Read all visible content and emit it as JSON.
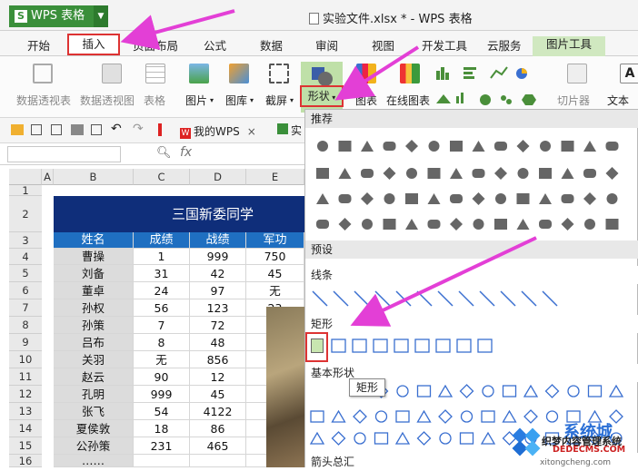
{
  "app": {
    "name": "WPS 表格",
    "doc_title": "实验文件.xlsx * - WPS 表格"
  },
  "tabs": [
    "开始",
    "插入",
    "页面布局",
    "公式",
    "数据",
    "审阅",
    "视图",
    "开发工具",
    "云服务",
    "图片工具"
  ],
  "ribbon": {
    "items": [
      "数据透视表",
      "数据透视图",
      "表格",
      "图片",
      "图库",
      "截屏",
      "形状",
      "图表",
      "在线图表",
      "切片器",
      "文本框"
    ]
  },
  "quickbar": {
    "wps_link": "我的WPS",
    "tab_partial": "实"
  },
  "formula": {
    "fx": "fx",
    "zoom_icon": "search-icon"
  },
  "sheet": {
    "columns": [
      "A",
      "B",
      "C",
      "D",
      "E"
    ],
    "rows": [
      "1",
      "2",
      "3",
      "4",
      "5",
      "6",
      "7",
      "8",
      "9",
      "10",
      "11",
      "12",
      "13",
      "14",
      "15",
      "16"
    ],
    "title": "三国新委同学",
    "headers": [
      "姓名",
      "成绩",
      "战绩",
      "军功"
    ],
    "data": [
      [
        "曹操",
        "1",
        "999",
        "750"
      ],
      [
        "刘备",
        "31",
        "42",
        "45"
      ],
      [
        "董卓",
        "24",
        "97",
        "无"
      ],
      [
        "孙权",
        "56",
        "123",
        "23"
      ],
      [
        "孙策",
        "7",
        "72",
        ""
      ],
      [
        "吕布",
        "8",
        "48",
        ""
      ],
      [
        "关羽",
        "无",
        "856",
        ""
      ],
      [
        "赵云",
        "90",
        "12",
        ""
      ],
      [
        "孔明",
        "999",
        "45",
        ""
      ],
      [
        "张飞",
        "54",
        "4122",
        ""
      ],
      [
        "夏侯敦",
        "18",
        "86",
        ""
      ],
      [
        "公孙策",
        "231",
        "465",
        ""
      ],
      [
        "……",
        "",
        "",
        ""
      ]
    ]
  },
  "panel": {
    "sections": [
      "推荐",
      "预设",
      "线条",
      "矩形",
      "基本形状",
      "箭头总汇"
    ],
    "tooltip": "矩形"
  },
  "watermark": {
    "line1": "织梦内容管理系统",
    "line2": "DEDECMS.COM",
    "brand": "系统城",
    "url": "xitongcheng.com"
  },
  "colors": {
    "accent_green": "#3a8f3a",
    "highlight_red": "#d33",
    "arrow_magenta": "#e33fd6",
    "table_title": "#0f2e7a",
    "table_header": "#1f6fc1"
  }
}
